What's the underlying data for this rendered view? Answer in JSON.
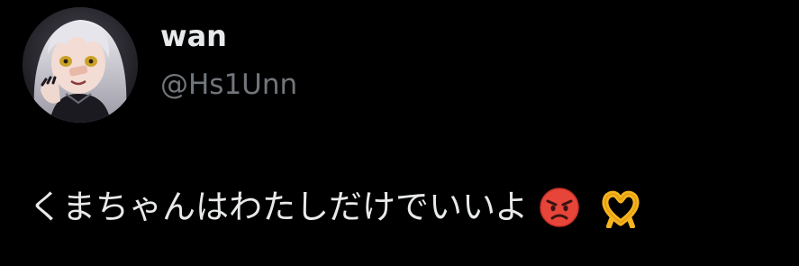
{
  "post": {
    "author": {
      "display_name": "wan",
      "handle": "@Hs1Unn",
      "avatar": "anime-girl-avatar"
    },
    "text": "くまちゃんはわたしだけでいいよ",
    "emojis": [
      "angry-face-emoji",
      "heart-hands-emoji"
    ]
  },
  "colors": {
    "background": "#000000",
    "primary_text": "#e7e9ea",
    "secondary_text": "#71767b"
  }
}
